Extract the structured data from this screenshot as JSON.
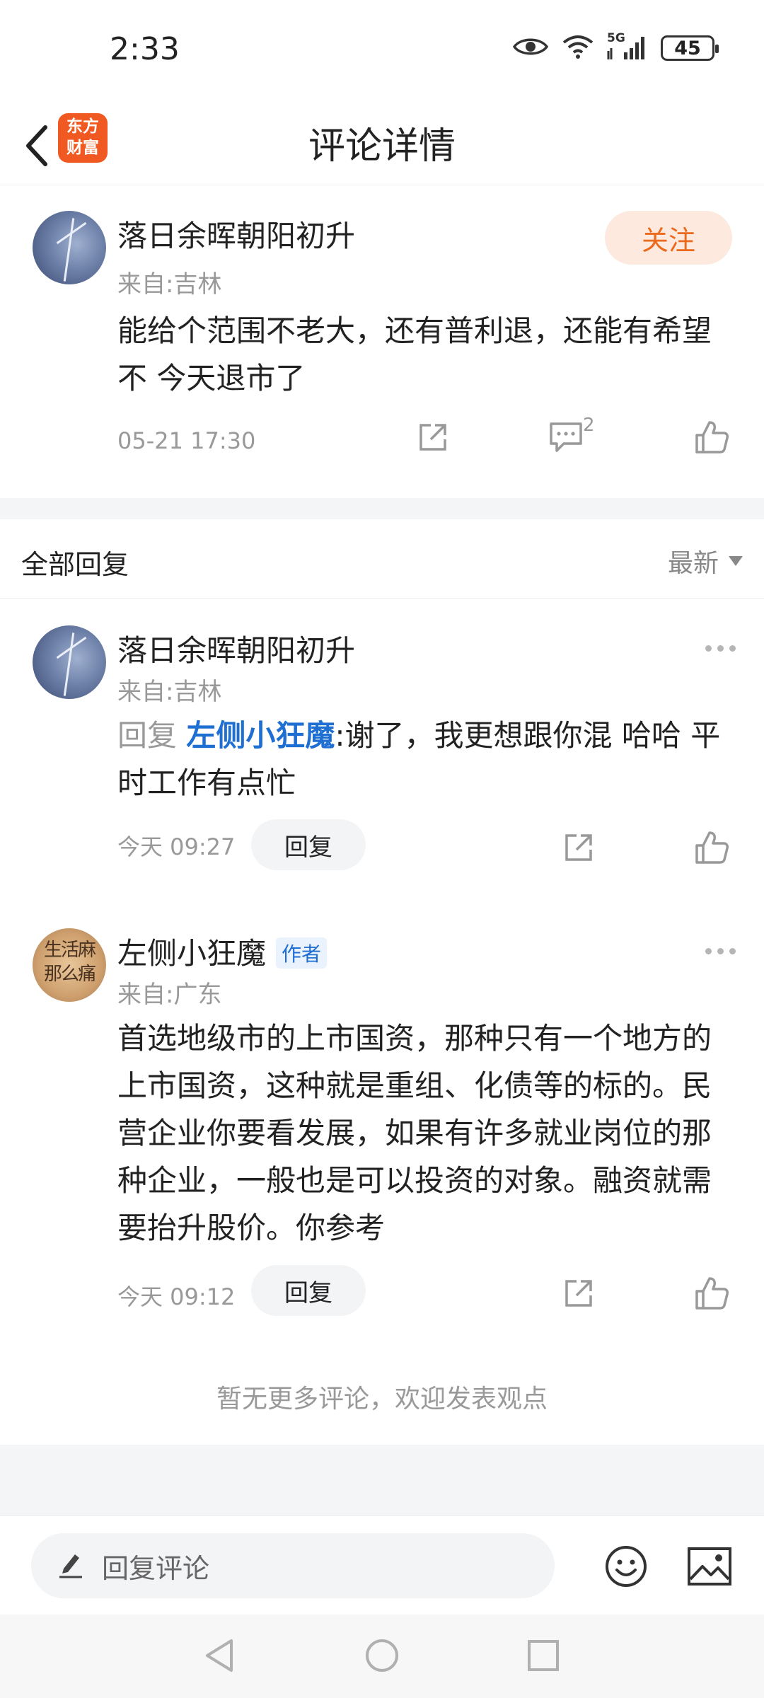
{
  "status_bar": {
    "time": "2:33",
    "network": "5G",
    "battery": "45"
  },
  "header": {
    "title": "评论详情",
    "logo_text": "东方财富"
  },
  "main_comment": {
    "user": "落日余晖朝阳初升",
    "location": "来自:吉林",
    "text": "能给个范围不老大，还有普利退，还能有希望不   今天退市了",
    "time": "05-21 17:30",
    "follow_label": "关注",
    "comment_count": "2"
  },
  "replies_section": {
    "title": "全部回复",
    "sort_label": "最新"
  },
  "replies": [
    {
      "user": "落日余晖朝阳初升",
      "location": "来自:吉林",
      "reply_prefix": "回复",
      "mention": "左侧小狂魔",
      "text": ":谢了，我更想跟你混  哈哈   平时工作有点忙",
      "time": "今天 09:27",
      "reply_label": "回复"
    },
    {
      "user": "左侧小狂魔",
      "badge": "作者",
      "location": "来自:广东",
      "text": "首选地级市的上市国资，那种只有一个地方的上市国资，这种就是重组、化债等的标的。民营企业你要看发展，如果有许多就业岗位的那种企业，一般也是可以投资的对象。融资就需要抬升股价。你参考",
      "time": "今天 09:12",
      "reply_label": "回复",
      "avatar_text": "生活麻那么痛"
    }
  ],
  "footer_note": "暂无更多评论，欢迎发表观点",
  "input_bar": {
    "placeholder": "回复评论"
  }
}
